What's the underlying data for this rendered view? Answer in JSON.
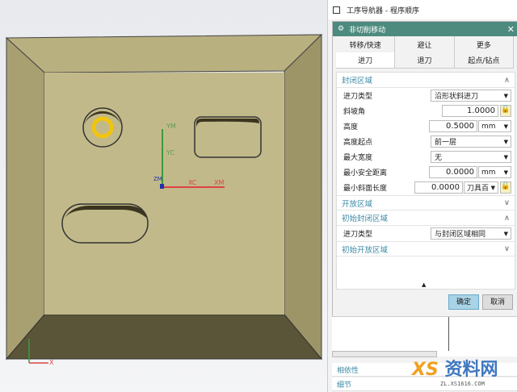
{
  "viewport": {
    "axes": {
      "ym": "YM",
      "yc": "YC",
      "xc": "XC",
      "xm": "XM",
      "zm": "ZM",
      "x": "X"
    },
    "model_color": "#c2b98a"
  },
  "navigator": {
    "title": "工序导航器 - 程序顺序"
  },
  "dialog": {
    "title": "非切削移动",
    "header_color": "#4d8b7f",
    "tabs_row1": [
      "转移/快速",
      "避让",
      "更多"
    ],
    "tabs_row2": [
      "进刀",
      "退刀",
      "起点/钻点"
    ],
    "active_tab": "进刀",
    "closed_region": {
      "title": "封闭区域",
      "entry_type_label": "进刀类型",
      "entry_type": "沿形状斜进刀",
      "ramp_angle_label": "斜坡角",
      "ramp_angle": "1.0000",
      "height_label": "高度",
      "height": "0.5000",
      "height_unit": "mm",
      "height_from_label": "高度起点",
      "height_from": "前一层",
      "max_width_label": "最大宽度",
      "max_width": "无",
      "min_clearance_label": "最小安全距离",
      "min_clearance": "0.0000",
      "min_clearance_unit": "mm",
      "min_ramp_length_label": "最小斜面长度",
      "min_ramp_length": "0.0000",
      "min_ramp_length_unit": "刀具百"
    },
    "open_region": {
      "title": "开放区域"
    },
    "initial_closed": {
      "title": "初始封闭区域",
      "entry_type_label": "进刀类型",
      "entry_type": "与封闭区域相同"
    },
    "initial_open": {
      "title": "初始开放区域"
    },
    "ok": "确定",
    "cancel": "取消"
  },
  "bottom": {
    "dependencies": "相依性",
    "details": "细节"
  },
  "watermark": {
    "name": "资料网",
    "url": "ZL.XS1616.COM"
  }
}
